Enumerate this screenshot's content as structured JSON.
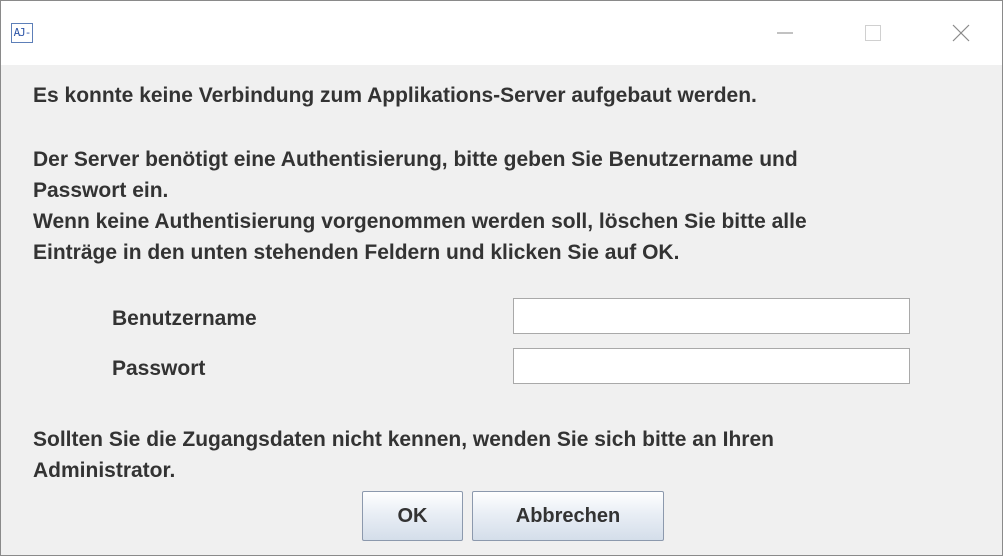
{
  "window": {
    "app_icon_text": "AJ-",
    "title": ""
  },
  "message": {
    "line1": "Es konnte keine Verbindung zum Applikations-Server aufgebaut werden.",
    "paragraph2": "Der Server benötigt eine Authentisierung, bitte geben Sie Benutzername und\nPasswort ein.\nWenn keine Authentisierung vorgenommen werden soll, löschen Sie bitte alle\nEinträge in den unten stehenden Feldern und klicken Sie auf OK.",
    "paragraph3": "Sollten Sie die Zugangsdaten nicht kennen, wenden Sie sich bitte an Ihren\nAdministrator."
  },
  "form": {
    "username_label": "Benutzername",
    "username_value": "",
    "password_label": "Passwort",
    "password_value": ""
  },
  "buttons": {
    "ok_label": "OK",
    "cancel_label": "Abbrechen"
  }
}
